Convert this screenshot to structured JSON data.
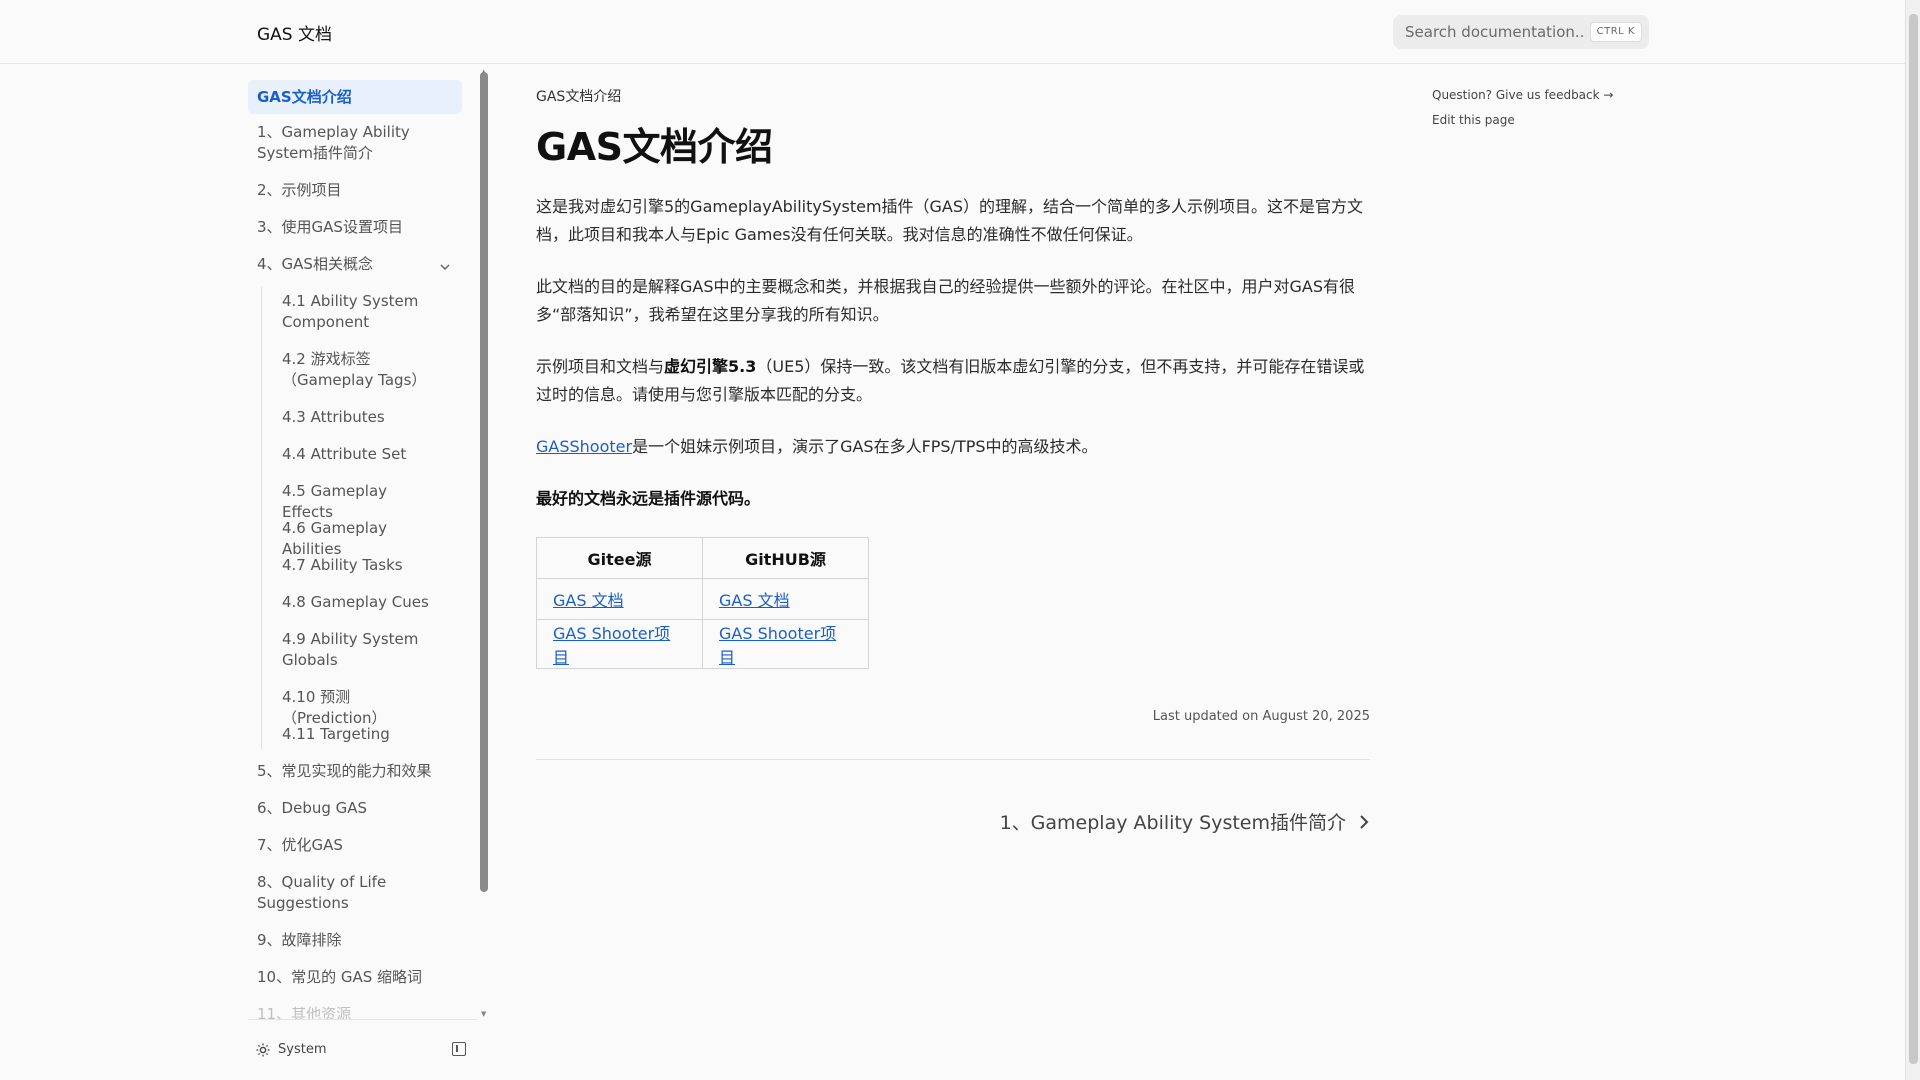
{
  "header": {
    "logo": "GAS 文档",
    "search_placeholder": "Search documentation...",
    "search_kbd": "CTRL K"
  },
  "sidebar": {
    "items": [
      {
        "label": "GAS文档介绍"
      },
      {
        "label": "1、Gameplay Ability System插件简介"
      },
      {
        "label": "2、示例项目"
      },
      {
        "label": "3、使用GAS设置项目"
      },
      {
        "label": "4、GAS相关概念"
      },
      {
        "label": "5、常见实现的能力和效果"
      },
      {
        "label": "6、Debug GAS"
      },
      {
        "label": "7、优化GAS"
      },
      {
        "label": "8、Quality of Life Suggestions"
      },
      {
        "label": "9、故障排除"
      },
      {
        "label": "10、常见的 GAS 缩略词"
      },
      {
        "label": "11、其他资源"
      }
    ],
    "subitems": [
      {
        "label": "4.1 Ability System Component"
      },
      {
        "label": "4.2 游戏标签（Gameplay Tags）"
      },
      {
        "label": "4.3 Attributes"
      },
      {
        "label": "4.4 Attribute Set"
      },
      {
        "label": "4.5 Gameplay Effects"
      },
      {
        "label": "4.6 Gameplay Abilities"
      },
      {
        "label": "4.7 Ability Tasks"
      },
      {
        "label": "4.8 Gameplay Cues"
      },
      {
        "label": "4.9 Ability System Globals"
      },
      {
        "label": "4.10 预测（Prediction）"
      },
      {
        "label": "4.11 Targeting"
      }
    ],
    "theme_label": "System"
  },
  "main": {
    "breadcrumb": "GAS文档介绍",
    "title": "GAS文档介绍",
    "p1": "这是我对虚幻引擎5的GameplayAbilitySystem插件（GAS）的理解，结合一个简单的多人示例项目。这不是官方文档，此项目和我本人与Epic Games没有任何关联。我对信息的准确性不做任何保证。",
    "p2": "此文档的目的是解释GAS中的主要概念和类，并根据我自己的经验提供一些额外的评论。在社区中，用户对GAS有很多“部落知识”，我希望在这里分享我的所有知识。",
    "p3_pre": "示例项目和文档与",
    "p3_bold": "虚幻引擎5.3",
    "p3_post": "（UE5）保持一致。该文档有旧版本虚幻引擎的分支，但不再支持，并可能存在错误或过时的信息。请使用与您引擎版本匹配的分支。",
    "p4_link": "GASShooter",
    "p4_post": "是一个姐妹示例项目，演示了GAS在多人FPS/TPS中的高级技术。",
    "p5": "最好的文档永远是插件源代码。",
    "table": {
      "headers": [
        "Gitee源",
        "GitHUB源"
      ],
      "rows": [
        [
          "GAS 文档",
          "GAS 文档"
        ],
        [
          "GAS Shooter项目",
          "GAS Shooter项目"
        ]
      ]
    },
    "last_updated": "Last updated on August 20, 2025",
    "next_label": "1、Gameplay Ability System插件简介"
  },
  "toc": {
    "feedback": "Question? Give us feedback →",
    "edit": "Edit this page"
  }
}
